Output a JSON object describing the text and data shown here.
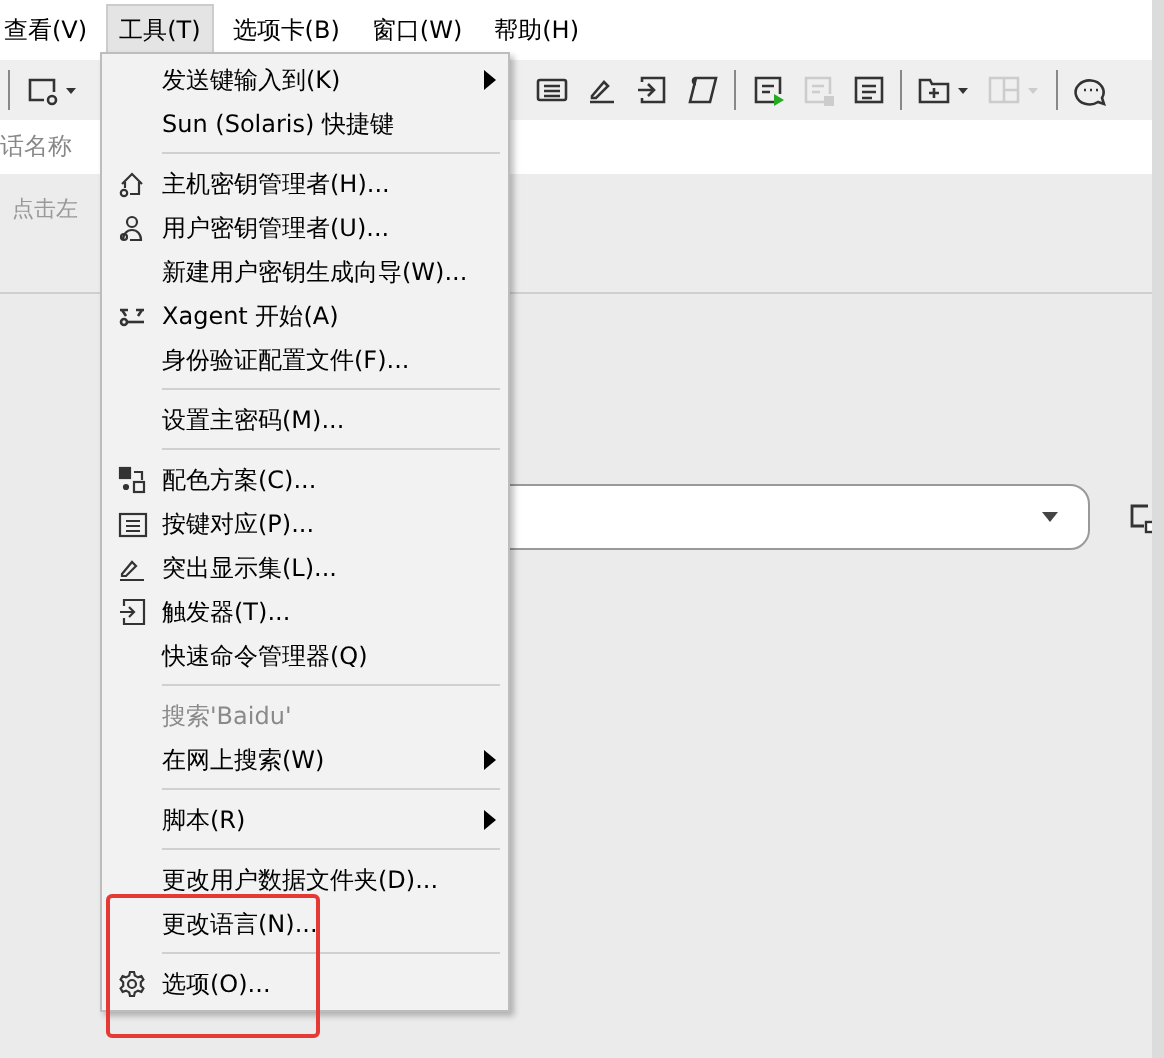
{
  "menubar": [
    {
      "label": "查看(V)",
      "selected": false
    },
    {
      "label": "工具(T)",
      "selected": true
    },
    {
      "label": "选项卡(B)",
      "selected": false
    },
    {
      "label": "窗口(W)",
      "selected": false
    },
    {
      "label": "帮助(H)",
      "selected": false
    }
  ],
  "toolbar": [
    {
      "kind": "separator"
    },
    {
      "kind": "new-session",
      "disabled": false
    },
    {
      "kind": "keyboard",
      "disabled": false
    },
    {
      "kind": "highlight",
      "disabled": false
    },
    {
      "kind": "trigger",
      "disabled": false
    },
    {
      "kind": "script",
      "disabled": false
    },
    {
      "kind": "separator"
    },
    {
      "kind": "log-start",
      "disabled": false
    },
    {
      "kind": "log-stop",
      "disabled": true
    },
    {
      "kind": "log",
      "disabled": false
    },
    {
      "kind": "separator"
    },
    {
      "kind": "new-tab",
      "disabled": false
    },
    {
      "kind": "layout",
      "disabled": true
    },
    {
      "kind": "separator"
    },
    {
      "kind": "chat",
      "disabled": false
    }
  ],
  "session_name_label": "话名称",
  "hint": "点击左",
  "menu": [
    {
      "kind": "item",
      "label": "发送键输入到(K)",
      "submenu": true,
      "disabled": false
    },
    {
      "kind": "item",
      "label": "Sun (Solaris) 快捷键",
      "submenu": false,
      "disabled": false
    },
    {
      "kind": "separator"
    },
    {
      "kind": "item",
      "label": "主机密钥管理者(H)...",
      "submenu": false,
      "disabled": false
    },
    {
      "kind": "item",
      "label": "用户密钥管理者(U)...",
      "submenu": false,
      "disabled": false
    },
    {
      "kind": "item",
      "label": "新建用户密钥生成向导(W)...",
      "submenu": false,
      "disabled": false
    },
    {
      "kind": "item",
      "label": "Xagent 开始(A)",
      "submenu": false,
      "disabled": false
    },
    {
      "kind": "item",
      "label": "身份验证配置文件(F)...",
      "submenu": false,
      "disabled": false
    },
    {
      "kind": "separator"
    },
    {
      "kind": "item",
      "label": "设置主密码(M)...",
      "submenu": false,
      "disabled": false
    },
    {
      "kind": "separator"
    },
    {
      "kind": "item",
      "label": "配色方案(C)...",
      "submenu": false,
      "disabled": false
    },
    {
      "kind": "item",
      "label": "按键对应(P)...",
      "submenu": false,
      "disabled": false
    },
    {
      "kind": "item",
      "label": "突出显示集(L)...",
      "submenu": false,
      "disabled": false
    },
    {
      "kind": "item",
      "label": "触发器(T)...",
      "submenu": false,
      "disabled": false
    },
    {
      "kind": "item",
      "label": "快速命令管理器(Q)",
      "submenu": false,
      "disabled": false
    },
    {
      "kind": "separator"
    },
    {
      "kind": "item",
      "label": "搜索'Baidu'",
      "submenu": false,
      "disabled": true
    },
    {
      "kind": "item",
      "label": "在网上搜索(W)",
      "submenu": true,
      "disabled": false
    },
    {
      "kind": "separator"
    },
    {
      "kind": "item",
      "label": "脚本(R)",
      "submenu": true,
      "disabled": false
    },
    {
      "kind": "separator"
    },
    {
      "kind": "item",
      "label": "更改用户数据文件夹(D)...",
      "submenu": false,
      "disabled": false
    },
    {
      "kind": "item",
      "label": "更改语言(N)...",
      "submenu": false,
      "disabled": false
    },
    {
      "kind": "separator"
    },
    {
      "kind": "item",
      "label": "选项(O)...",
      "submenu": false,
      "disabled": false
    }
  ]
}
